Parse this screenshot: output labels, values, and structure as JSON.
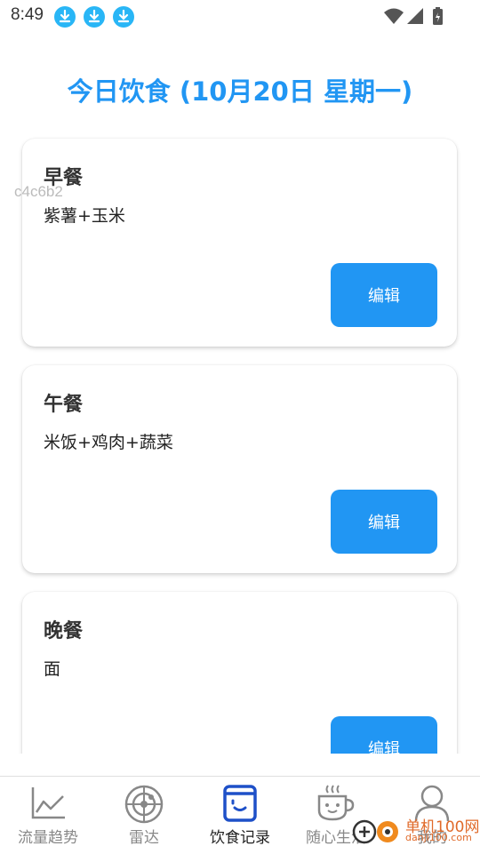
{
  "status_bar": {
    "time": "8:49"
  },
  "page_title": "今日饮食 (10月20日 星期一)",
  "watermark_id": "c4c6b2",
  "meals": [
    {
      "name": "早餐",
      "content": "紫薯+玉米",
      "edit_label": "编辑"
    },
    {
      "name": "午餐",
      "content": "米饭+鸡肉+蔬菜",
      "edit_label": "编辑"
    },
    {
      "name": "晚餐",
      "content": "面",
      "edit_label": "编辑"
    }
  ],
  "bottom_nav": {
    "items": [
      {
        "label": "流量趋势",
        "icon": "trend-chart-icon",
        "active": false
      },
      {
        "label": "雷达",
        "icon": "radar-icon",
        "active": false
      },
      {
        "label": "饮食记录",
        "icon": "food-record-icon",
        "active": true
      },
      {
        "label": "随心生活",
        "icon": "coffee-cup-icon",
        "active": false
      },
      {
        "label": "我的",
        "icon": "user-icon",
        "active": false
      }
    ]
  },
  "overlay_watermark": {
    "text": "单机100网",
    "sub": "danji100.com"
  },
  "colors": {
    "accent": "#2196f3",
    "download_badge": "#29b6f6"
  }
}
